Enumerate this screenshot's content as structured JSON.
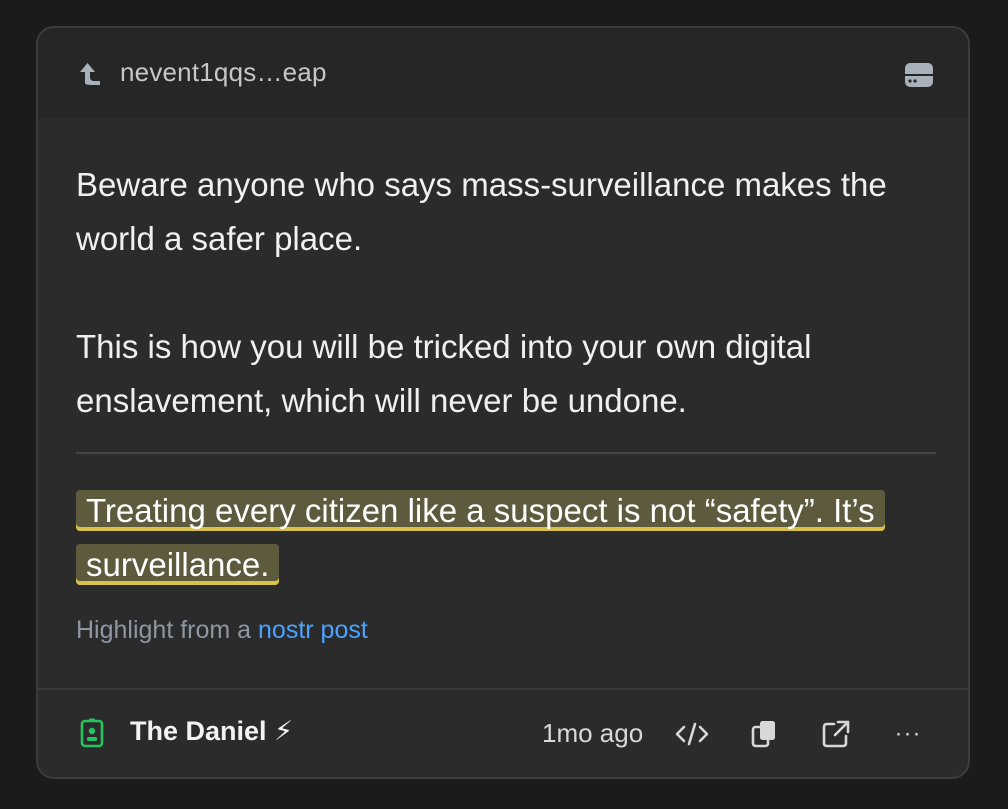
{
  "header": {
    "event_id": "nevent1qqs…eap",
    "reply_icon": "reply-arrow-icon",
    "relay_icon": "server-icon"
  },
  "content": {
    "paragraph_1": "Beware anyone who says mass-surveillance makes the world a safer place.",
    "paragraph_2": "This is how you will be tricked into your own digital enslavement, which will never be undone."
  },
  "highlight": {
    "text": "Treating every citizen like a suspect is not “safety”. It’s surveillance.",
    "color": "#d9c24a"
  },
  "source": {
    "prefix": "Highlight from a ",
    "link_text": "nostr post",
    "link_color": "#4aa3ff"
  },
  "footer": {
    "author_name": "The Daniel ⚡",
    "author_icon": "id-badge-icon",
    "author_icon_color": "#22c55e",
    "timestamp": "1mo ago",
    "more_label": "···"
  }
}
